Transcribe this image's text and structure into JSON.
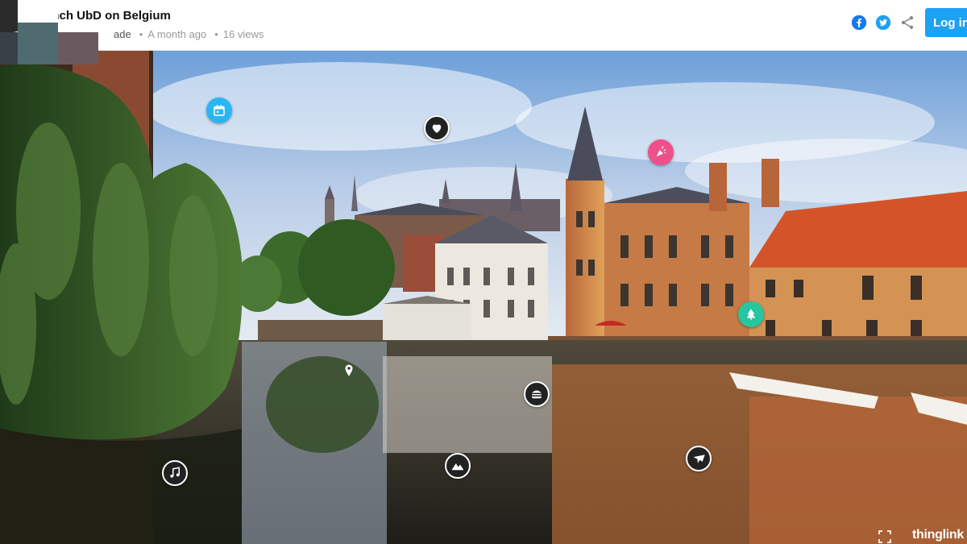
{
  "header": {
    "title": "French UbD on Belgium",
    "author": "ade",
    "age": "A month ago",
    "views": "16 views",
    "separator": "•",
    "login_label": "Log in"
  },
  "share": {
    "facebook_color": "#1877f2",
    "twitter_color": "#1da1f2",
    "share_color": "#888888"
  },
  "hotspots": [
    {
      "name": "calendar-hotspot",
      "icon": "calendar-icon",
      "color": "#29b6f6"
    },
    {
      "name": "heart-hotspot",
      "icon": "heart-icon",
      "color": "#222222"
    },
    {
      "name": "party-hotspot",
      "icon": "party-popper-icon",
      "color": "#f0508a"
    },
    {
      "name": "tree-hotspot",
      "icon": "tree-icon",
      "color": "#26c6a0"
    },
    {
      "name": "location-hotspot",
      "icon": "map-pin-icon",
      "color": "transparent"
    },
    {
      "name": "burger-hotspot",
      "icon": "burger-icon",
      "color": "#222222"
    },
    {
      "name": "music-hotspot",
      "icon": "music-note-icon",
      "color": "#222222"
    },
    {
      "name": "mountain-hotspot",
      "icon": "mountain-icon",
      "color": "#222222"
    },
    {
      "name": "plane-hotspot",
      "icon": "plane-icon",
      "color": "#222222"
    }
  ],
  "footer": {
    "brand": "thinglink"
  }
}
